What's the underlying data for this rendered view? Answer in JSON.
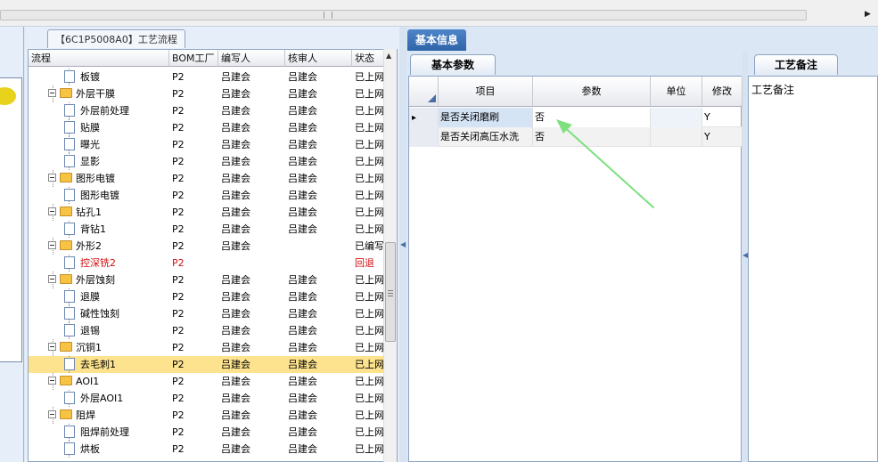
{
  "left_tab": {
    "label": "【6C1P5008A0】工艺流程"
  },
  "route_grid": {
    "columns": [
      "流程",
      "BOM工厂",
      "编写人",
      "核审人",
      "状态"
    ],
    "rows": [
      {
        "name": "板镀",
        "level": 2,
        "bom": "P2",
        "writer": "吕建会",
        "reviewer": "吕建会",
        "status": "已上网",
        "folder": false
      },
      {
        "name": "外层干膜",
        "level": 1,
        "bom": "P2",
        "writer": "吕建会",
        "reviewer": "吕建会",
        "status": "已上网",
        "folder": true
      },
      {
        "name": "外层前处理",
        "level": 2,
        "bom": "P2",
        "writer": "吕建会",
        "reviewer": "吕建会",
        "status": "已上网",
        "folder": false
      },
      {
        "name": "贴膜",
        "level": 2,
        "bom": "P2",
        "writer": "吕建会",
        "reviewer": "吕建会",
        "status": "已上网",
        "folder": false
      },
      {
        "name": "曝光",
        "level": 2,
        "bom": "P2",
        "writer": "吕建会",
        "reviewer": "吕建会",
        "status": "已上网",
        "folder": false
      },
      {
        "name": "显影",
        "level": 2,
        "bom": "P2",
        "writer": "吕建会",
        "reviewer": "吕建会",
        "status": "已上网",
        "folder": false
      },
      {
        "name": "图形电镀",
        "level": 1,
        "bom": "P2",
        "writer": "吕建会",
        "reviewer": "吕建会",
        "status": "已上网",
        "folder": true
      },
      {
        "name": "图形电镀",
        "level": 2,
        "bom": "P2",
        "writer": "吕建会",
        "reviewer": "吕建会",
        "status": "已上网",
        "folder": false
      },
      {
        "name": "钻孔1",
        "level": 1,
        "bom": "P2",
        "writer": "吕建会",
        "reviewer": "吕建会",
        "status": "已上网",
        "folder": true
      },
      {
        "name": "背钻1",
        "level": 2,
        "bom": "P2",
        "writer": "吕建会",
        "reviewer": "吕建会",
        "status": "已上网",
        "folder": false
      },
      {
        "name": "外形2",
        "level": 1,
        "bom": "P2",
        "writer": "吕建会",
        "reviewer": "",
        "status": "已编写",
        "folder": true
      },
      {
        "name": "控深铣2",
        "level": 2,
        "bom": "P2",
        "writer": "",
        "reviewer": "",
        "status": "回退",
        "folder": false,
        "red": true
      },
      {
        "name": "外层蚀刻",
        "level": 1,
        "bom": "P2",
        "writer": "吕建会",
        "reviewer": "吕建会",
        "status": "已上网",
        "folder": true
      },
      {
        "name": "退膜",
        "level": 2,
        "bom": "P2",
        "writer": "吕建会",
        "reviewer": "吕建会",
        "status": "已上网",
        "folder": false
      },
      {
        "name": "碱性蚀刻",
        "level": 2,
        "bom": "P2",
        "writer": "吕建会",
        "reviewer": "吕建会",
        "status": "已上网",
        "folder": false
      },
      {
        "name": "退锡",
        "level": 2,
        "bom": "P2",
        "writer": "吕建会",
        "reviewer": "吕建会",
        "status": "已上网",
        "folder": false
      },
      {
        "name": "沉铜1",
        "level": 1,
        "bom": "P2",
        "writer": "吕建会",
        "reviewer": "吕建会",
        "status": "已上网",
        "folder": true
      },
      {
        "name": "去毛刺1",
        "level": 2,
        "bom": "P2",
        "writer": "吕建会",
        "reviewer": "吕建会",
        "status": "已上网",
        "folder": false,
        "selected": true
      },
      {
        "name": "AOI1",
        "level": 1,
        "bom": "P2",
        "writer": "吕建会",
        "reviewer": "吕建会",
        "status": "已上网",
        "folder": true
      },
      {
        "name": "外层AOI1",
        "level": 2,
        "bom": "P2",
        "writer": "吕建会",
        "reviewer": "吕建会",
        "status": "已上网",
        "folder": false
      },
      {
        "name": "阻焊",
        "level": 1,
        "bom": "P2",
        "writer": "吕建会",
        "reviewer": "吕建会",
        "status": "已上网",
        "folder": true
      },
      {
        "name": "阻焊前处理",
        "level": 2,
        "bom": "P2",
        "writer": "吕建会",
        "reviewer": "吕建会",
        "status": "已上网",
        "folder": false
      },
      {
        "name": "烘板",
        "level": 2,
        "bom": "P2",
        "writer": "吕建会",
        "reviewer": "吕建会",
        "status": "已上网",
        "folder": false
      }
    ]
  },
  "mid_tab": {
    "label": "基本信息"
  },
  "params_tab": {
    "label": "基本参数"
  },
  "param_grid": {
    "columns": [
      "项目",
      "参数",
      "单位",
      "修改"
    ],
    "rows": [
      {
        "item": "是否关闭磨刷",
        "param": "否",
        "unit": "",
        "modify": "Y"
      },
      {
        "item": "是否关闭高压水洗",
        "param": "否",
        "unit": "",
        "modify": "Y"
      }
    ]
  },
  "remark_tab": {
    "label": "工艺备注"
  },
  "remark_panel": {
    "label": "工艺备注"
  },
  "annotation": {
    "color": "#7ee07e"
  }
}
